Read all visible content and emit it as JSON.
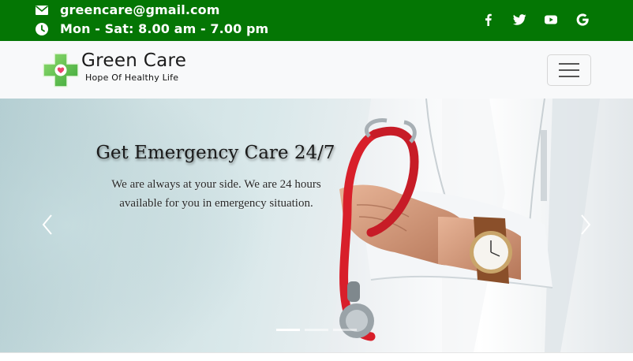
{
  "topbar": {
    "email": "greencare@gmail.com",
    "hours": "Mon - Sat: 8.00 am - 7.00 pm",
    "socials": [
      {
        "name": "facebook-icon",
        "glyph": "f"
      },
      {
        "name": "twitter-icon",
        "glyph": "t"
      },
      {
        "name": "youtube-icon",
        "glyph": "y"
      },
      {
        "name": "google-icon",
        "glyph": "G"
      }
    ],
    "color": "#047604"
  },
  "navbar": {
    "brand_name": "Green Care",
    "brand_tagline": "Hope Of Healthy Life",
    "logo_icon": "green-cross-heart-icon",
    "toggler_icon": "hamburger-menu-icon"
  },
  "hero": {
    "title": "Get Emergency Care 24/7",
    "text": "We are always at your side. We are 24 hours available for you in emergency situation.",
    "prev_icon": "chevron-left-icon",
    "next_icon": "chevron-right-icon",
    "slides": 3,
    "active_slide": 1
  }
}
